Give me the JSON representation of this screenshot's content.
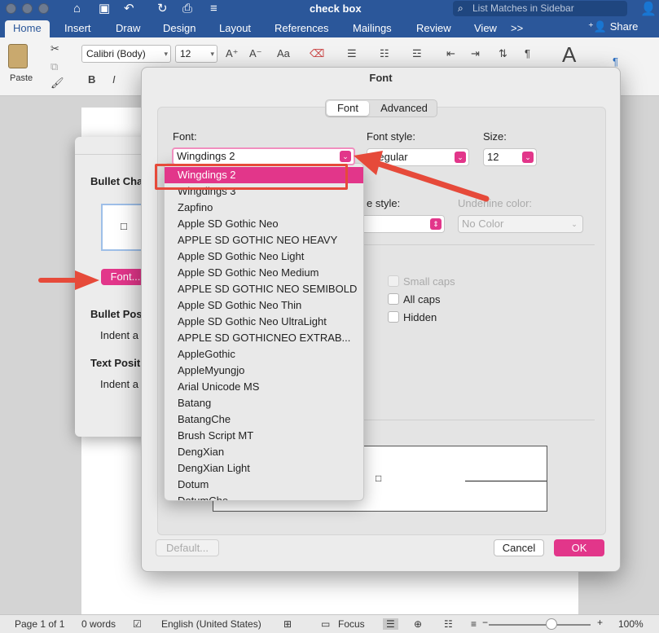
{
  "app": {
    "doc_title": "check box",
    "search_placeholder": "List Matches in Sidebar",
    "share_label": "Share"
  },
  "ribbon": {
    "tabs": [
      "Home",
      "Insert",
      "Draw",
      "Design",
      "Layout",
      "References",
      "Mailings",
      "Review",
      "View"
    ],
    "more_tabs": ">>",
    "paste_label": "Paste",
    "font_name": "Calibri (Body)",
    "font_size": "12"
  },
  "bullet_dialog": {
    "bullet_char_label": "Bullet Cha",
    "font_button": "Font...",
    "bullet_pos_label": "Bullet Pos",
    "indent_1": "Indent a",
    "text_pos_label": "Text Posit",
    "indent_2": "Indent a",
    "preview_glyph": "□"
  },
  "font_dialog": {
    "title": "Font",
    "tab_font": "Font",
    "tab_advanced": "Advanced",
    "font_label": "Font:",
    "font_value": "Wingdings 2",
    "style_label": "Font style:",
    "style_value": "Regular",
    "size_label": "Size:",
    "size_value": "12",
    "underline_style_label": "e style:",
    "underline_color_label": "Underline color:",
    "underline_color_value": "No Color",
    "small_caps": "Small caps",
    "all_caps": "All caps",
    "hidden": "Hidden",
    "preview_glyph": "□",
    "default_button": "Default...",
    "cancel_button": "Cancel",
    "ok_button": "OK"
  },
  "font_list": [
    "Wingdings 2",
    "Wingdings 3",
    "Zapfino",
    "Apple SD Gothic Neo",
    "APPLE SD GOTHIC NEO HEAVY",
    "Apple SD Gothic Neo Light",
    "Apple SD Gothic Neo Medium",
    "APPLE SD GOTHIC NEO SEMIBOLD",
    "Apple SD Gothic Neo Thin",
    "Apple SD Gothic Neo UltraLight",
    "APPLE SD GOTHICNEO EXTRAB...",
    "AppleGothic",
    "AppleMyungjo",
    "Arial Unicode MS",
    "Batang",
    "BatangChe",
    "Brush Script MT",
    "DengXian",
    "DengXian Light",
    "Dotum",
    "DotumChe"
  ],
  "status": {
    "page": "Page 1 of 1",
    "words": "0 words",
    "language": "English (United States)",
    "focus": "Focus",
    "zoom": "100%"
  },
  "colors": {
    "accent": "#e2368a",
    "ribbon_blue": "#2b579a",
    "annotation_red": "#e64a3a"
  }
}
